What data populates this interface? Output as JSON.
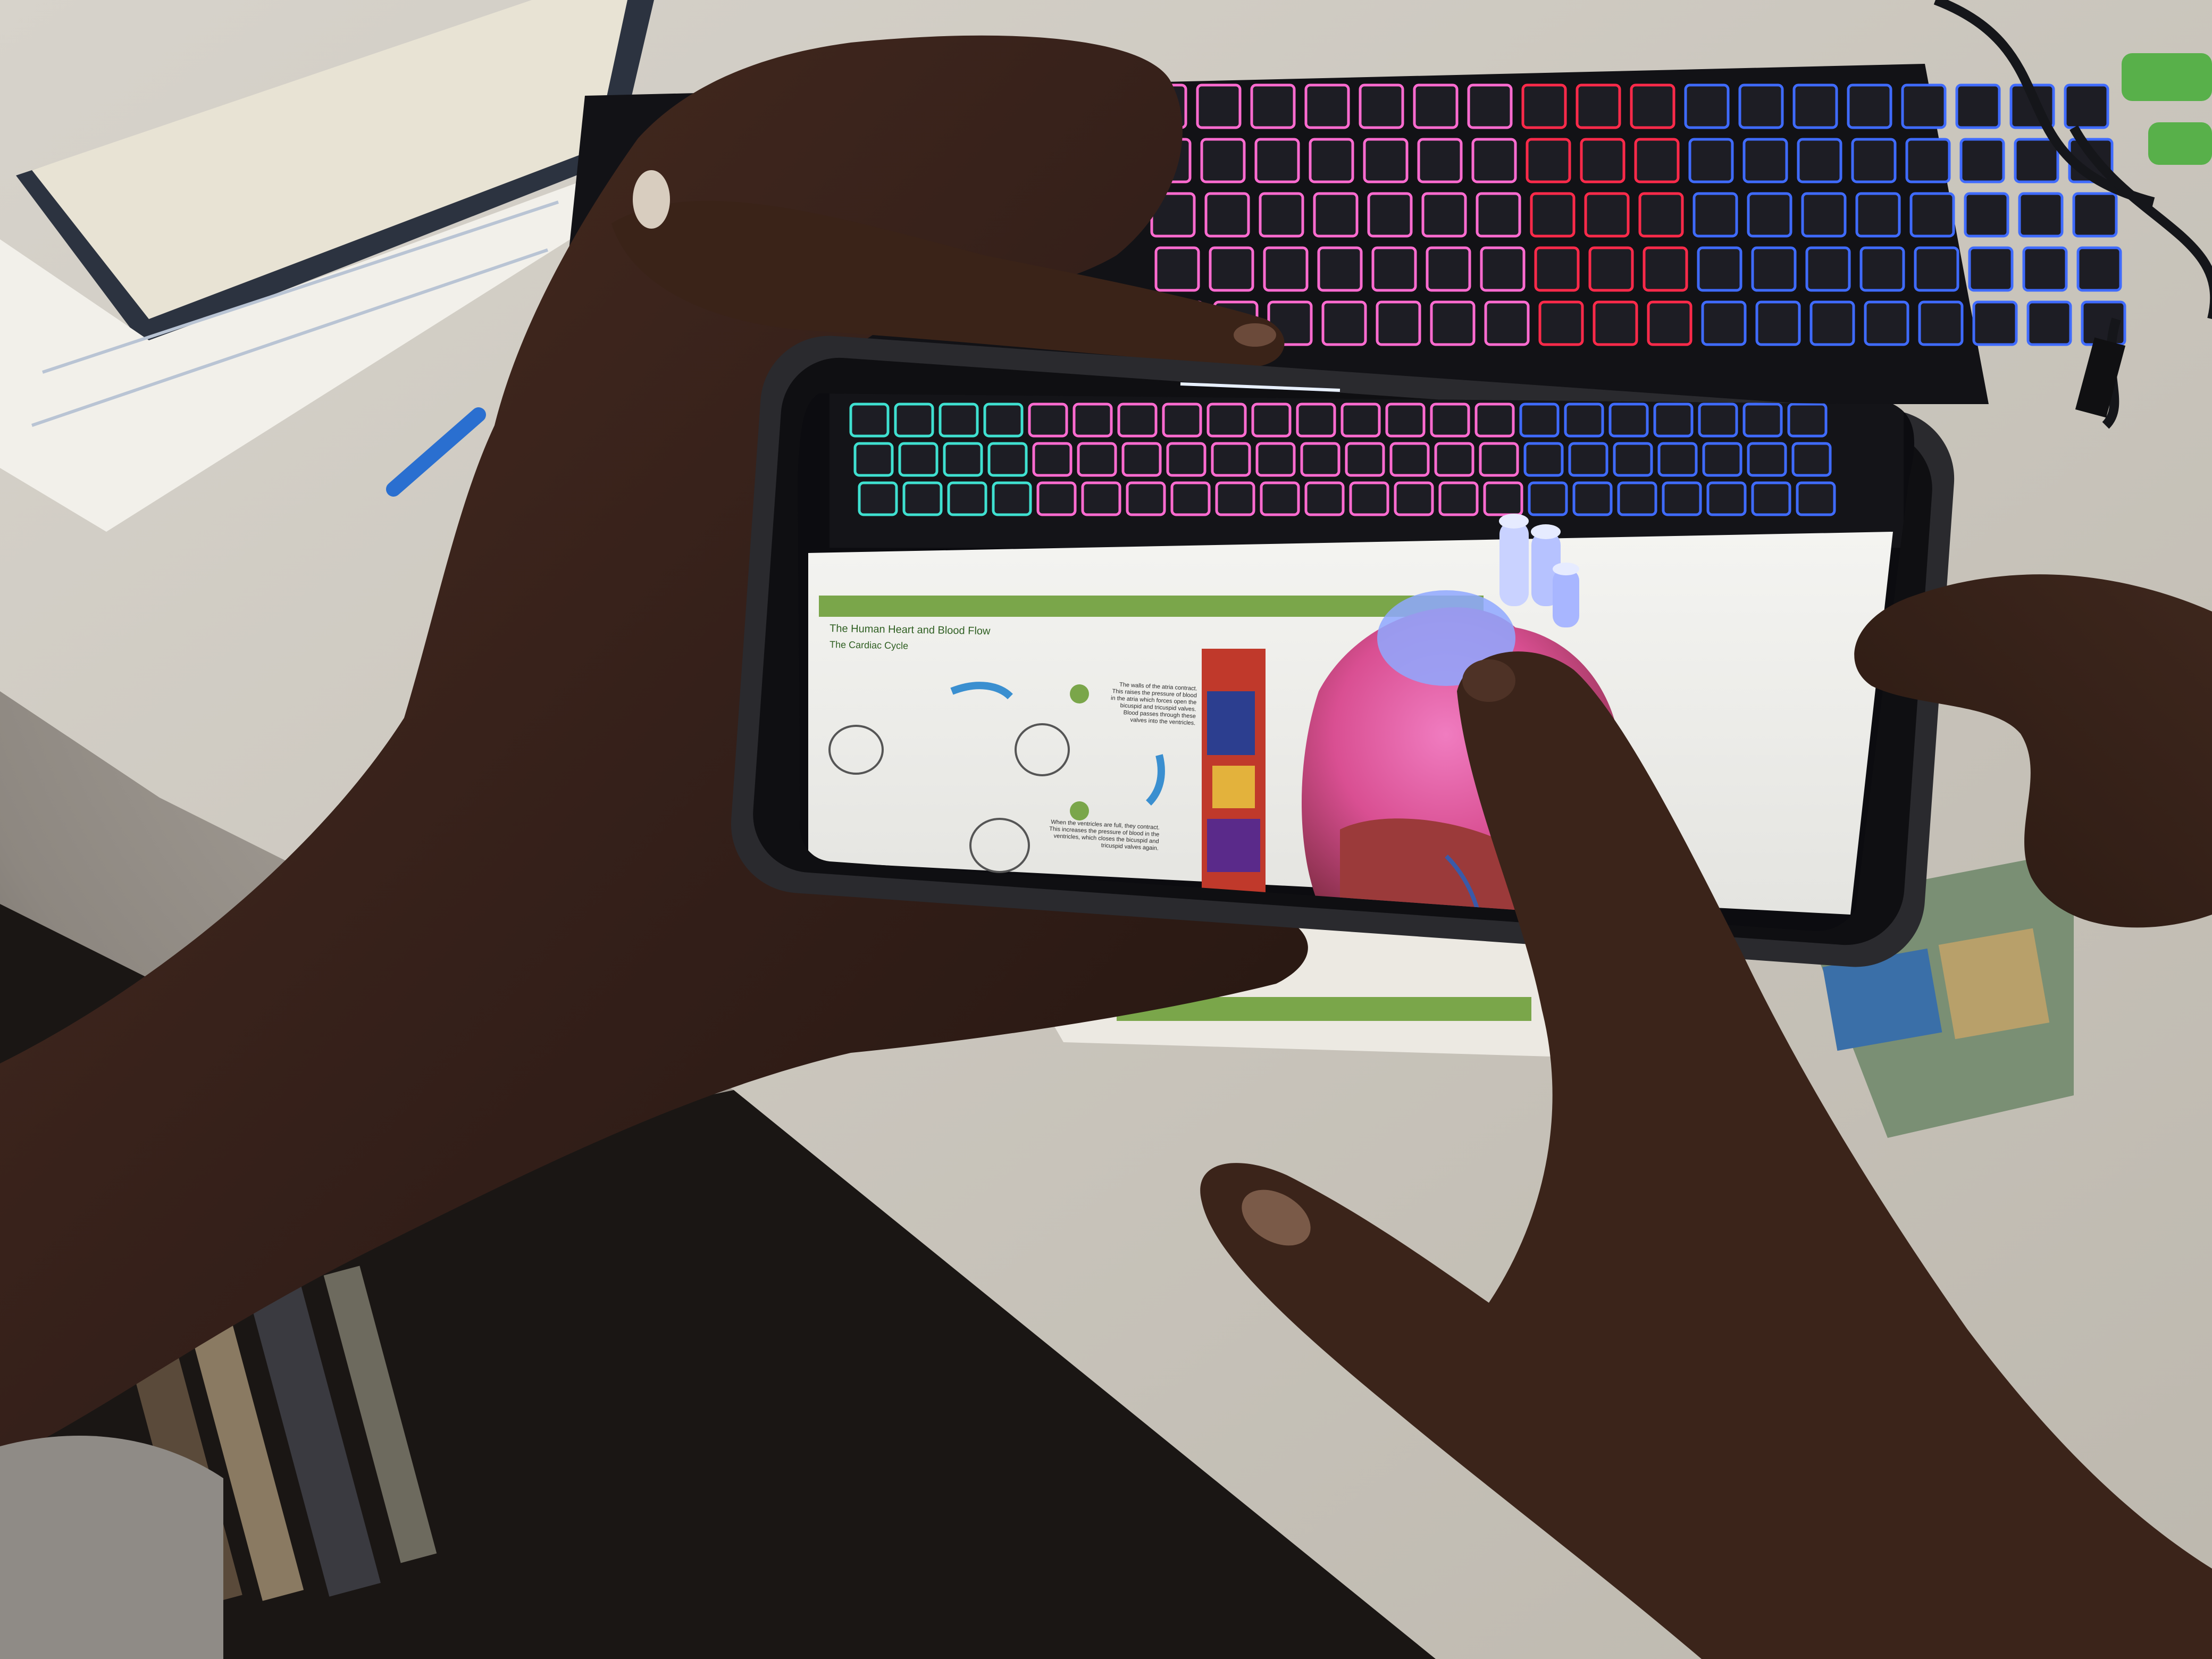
{
  "scene": {
    "description_tag": "hands-holding-phone-ar-heart",
    "colors": {
      "desk": "#d9d4cc",
      "keyboard": "#121216",
      "key_glow_blue": "#3f6bff",
      "key_glow_red": "#ff2a4a",
      "key_glow_pink": "#ff6bd0",
      "skin": "#3a2318",
      "phone_frame": "#2a2a2e",
      "paper": "#f2f1ec",
      "heart_pink": "#e85aa8",
      "heart_blue": "#8fa8ff",
      "doc_green": "#7aa64a"
    }
  },
  "phone_screen": {
    "ar_document": {
      "header_title": "The Human Heart and Blood Flow",
      "section_title": "The Cardiac Cycle",
      "step_top_text": "The walls of the atria contract. This raises the pressure of blood in the atria which forces open the bicuspid and tricuspid valves. Blood passes through these valves into the ventricles.",
      "step_bottom_text": "When the ventricles are full, they contract. This increases the pressure of blood in the ventricles, which closes the bicuspid and tricuspid valves again."
    },
    "ar_model": "3d-heart-model"
  }
}
